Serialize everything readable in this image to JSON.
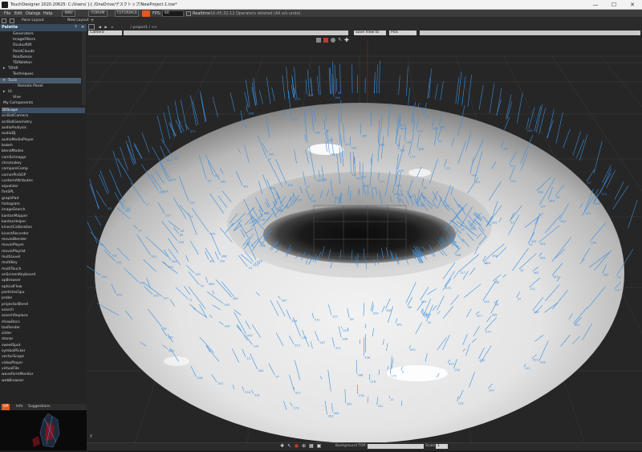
{
  "window": {
    "title": "TouchDesigner 2020.20625: C:/Users/ }{ /OneDrive/デスクトップ/NewProject.1.toe*",
    "controls": [
      "—",
      "☐",
      "✕"
    ]
  },
  "menu": {
    "items": [
      "File",
      "Edit",
      "Dialogs",
      "Help"
    ],
    "wiki": "WIKI",
    "forum": "FORUM",
    "tutorials": "TUTORIALS",
    "fps_label": "FPS:",
    "fps_value": "60",
    "realtime": "Realtime",
    "status_message": "16:45:32:12  Operators deleted (All o/s undo)."
  },
  "tabbar": {
    "pane_layout": "Pane Layout",
    "new_layout": "New Layout",
    "path": "/ project1 / <<"
  },
  "palette": {
    "title": "Palette",
    "tree": [
      {
        "label": "Generators",
        "indent": 2
      },
      {
        "label": "ImageFilters",
        "indent": 2
      },
      {
        "label": "OculusRift",
        "indent": 2
      },
      {
        "label": "PointClouds",
        "indent": 2
      },
      {
        "label": "RealSense",
        "indent": 2
      },
      {
        "label": "TDAbleton",
        "indent": 2
      },
      {
        "label": "TDVR",
        "indent": 1,
        "arrow": "▸"
      },
      {
        "label": "Techniques",
        "indent": 2
      },
      {
        "label": "Tools",
        "indent": 1,
        "arrow": "▾",
        "selected": true
      },
      {
        "label": "Remote Panel",
        "indent": 3
      },
      {
        "label": "UI",
        "indent": 1,
        "arrow": "▸"
      },
      {
        "label": "Vive",
        "indent": 2
      },
      {
        "label": "My Components",
        "indent": 0
      }
    ],
    "components": [
      "3DScope",
      "arcBallCamera",
      "arcBallGeometry",
      "audioAnalysis",
      "audioDJ",
      "audioMediaPlayer",
      "bokeh",
      "blendModes",
      "camSchnappr",
      "chromakey",
      "compareComp",
      "cornerPinSOP",
      "customAttributes",
      "equalizer",
      "fireSPL",
      "graphPad",
      "histogram",
      "imageSearch",
      "kantanMapper",
      "kantanHelper",
      "kinectCalibration",
      "kinectRecorder",
      "movieBlender",
      "moviePlayer",
      "moviePlaylist",
      "multiLevel",
      "multiKey",
      "multiTouch",
      "onScreenKeyboard",
      "opBrowser",
      "opticalFlow",
      "particlesGpu",
      "probe",
      "projectorBlend",
      "search",
      "searchReplace",
      "showDocs",
      "toxRender",
      "slider",
      "stoner",
      "sweetSpot",
      "symbolPicker",
      "vectorScope",
      "videoPlayer",
      "virtualFile",
      "waveformMonitor",
      "webBrowser"
    ],
    "selected_index": 0
  },
  "bottom_left": {
    "tabs": [
      "OP",
      "Info",
      "Suggestions"
    ]
  },
  "viewer": {
    "camera_field": "Camera",
    "dropdown_1": "Save View to",
    "dropdown_2": "Pick",
    "axis_label": "y"
  },
  "statusbar": {
    "background_label": "Background TOP:",
    "scale_label": "Scale:",
    "scale_value": "1"
  },
  "colors": {
    "accent": "#e05a1e",
    "normals": "#3a8fe0",
    "palette_header": "#374a5c"
  }
}
